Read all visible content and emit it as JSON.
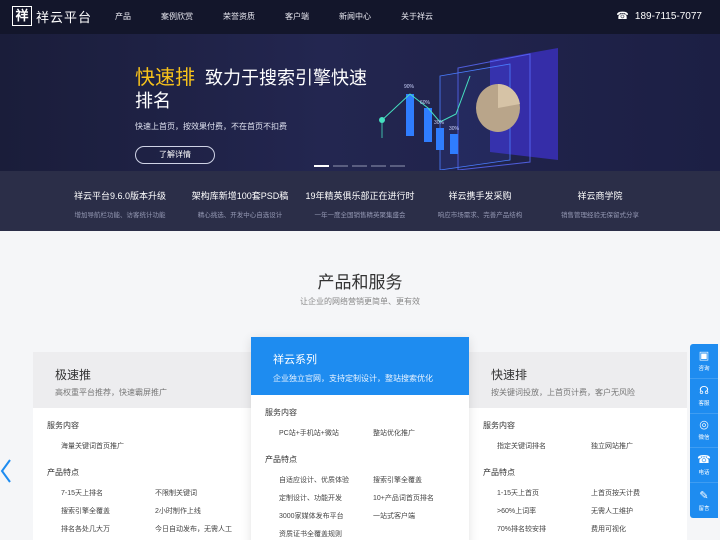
{
  "header": {
    "logo_mark": "祥",
    "logo_text": "祥云平台",
    "menu": [
      "产品",
      "案例欣赏",
      "荣誉资质",
      "客户端",
      "新闻中心",
      "关于祥云"
    ],
    "phone": "189-7115-7077",
    "phone_icon": "phone-icon"
  },
  "hero": {
    "title_highlight": "快速排",
    "title_rest": "致力于搜索引擎快速排名",
    "subtitle": "快速上首页，按效果付费，不在首页不扣费",
    "button": "了解详情",
    "chart_labels": [
      "90%",
      "60%",
      "30%",
      "30%"
    ],
    "slide_count": 5,
    "active_slide": 1
  },
  "strip": [
    {
      "title": "祥云平台9.6.0版本升级",
      "desc": "增加导航栏功能、访客统计功能"
    },
    {
      "title": "架构库新增100套PSD稿",
      "desc": "精心挑选、开发中心自选设计"
    },
    {
      "title": "19年精英俱乐部正在进行时",
      "desc": "一年一度全国销售精英聚集盛会"
    },
    {
      "title": "祥云携手发采购",
      "desc": "响应市场需求、完善产品结构"
    },
    {
      "title": "祥云商学院",
      "desc": "销售管理经验无保留式分享"
    }
  ],
  "section": {
    "title": "产品和服务",
    "subtitle": "让企业的网络营销更简单、更有效"
  },
  "cards": {
    "left": {
      "name": "极速推",
      "desc": "高权重平台推荐，快速霸屏推广",
      "services_label": "服务内容",
      "services": [
        "海量关键词首页推广"
      ],
      "features_label": "产品特点",
      "features": [
        "7-15天上排名",
        "不限制关键词",
        "搜索引擎全覆盖",
        "2小时制作上线",
        "排名各处几大万",
        "今日自动发布，无需人工"
      ]
    },
    "center": {
      "name": "祥云系列",
      "desc": "企业独立官网，支持定制设计，整站搜索优化",
      "services_label": "服务内容",
      "services": [
        "PC站+手机站+微站",
        "整站优化推广"
      ],
      "features_label": "产品特点",
      "features": [
        "自适应设计、优质体验",
        "搜索引擎全覆盖",
        "定制设计、功能开发",
        "10+产品词首页排名",
        "3000家媒体发布平台",
        "一站式客户端",
        "资质证书全覆盖规则",
        ""
      ]
    },
    "right": {
      "name": "快速排",
      "desc": "按关键词投放，上首页计费，客户无风险",
      "services_label": "服务内容",
      "services": [
        "指定关键词排名",
        "独立网站推广"
      ],
      "features_label": "产品特点",
      "features": [
        "1-15天上首页",
        "上首页按天计费",
        ">60%上词率",
        "无需人工维护",
        "70%排名较安排",
        "费用可视化"
      ]
    }
  },
  "sidebar": [
    {
      "icon": "chat-icon",
      "label": "咨询"
    },
    {
      "icon": "headset-icon",
      "label": "客服"
    },
    {
      "icon": "wechat-icon",
      "label": "微信"
    },
    {
      "icon": "telephone-icon",
      "label": "电话"
    },
    {
      "icon": "edit-icon",
      "label": "留言"
    }
  ],
  "colors": {
    "header_bg": "#13162b",
    "hero_bg": "#1f2245",
    "highlight": "#f7c21b",
    "strip_bg": "#2b2e48",
    "accent_blue": "#1e8cf0"
  }
}
